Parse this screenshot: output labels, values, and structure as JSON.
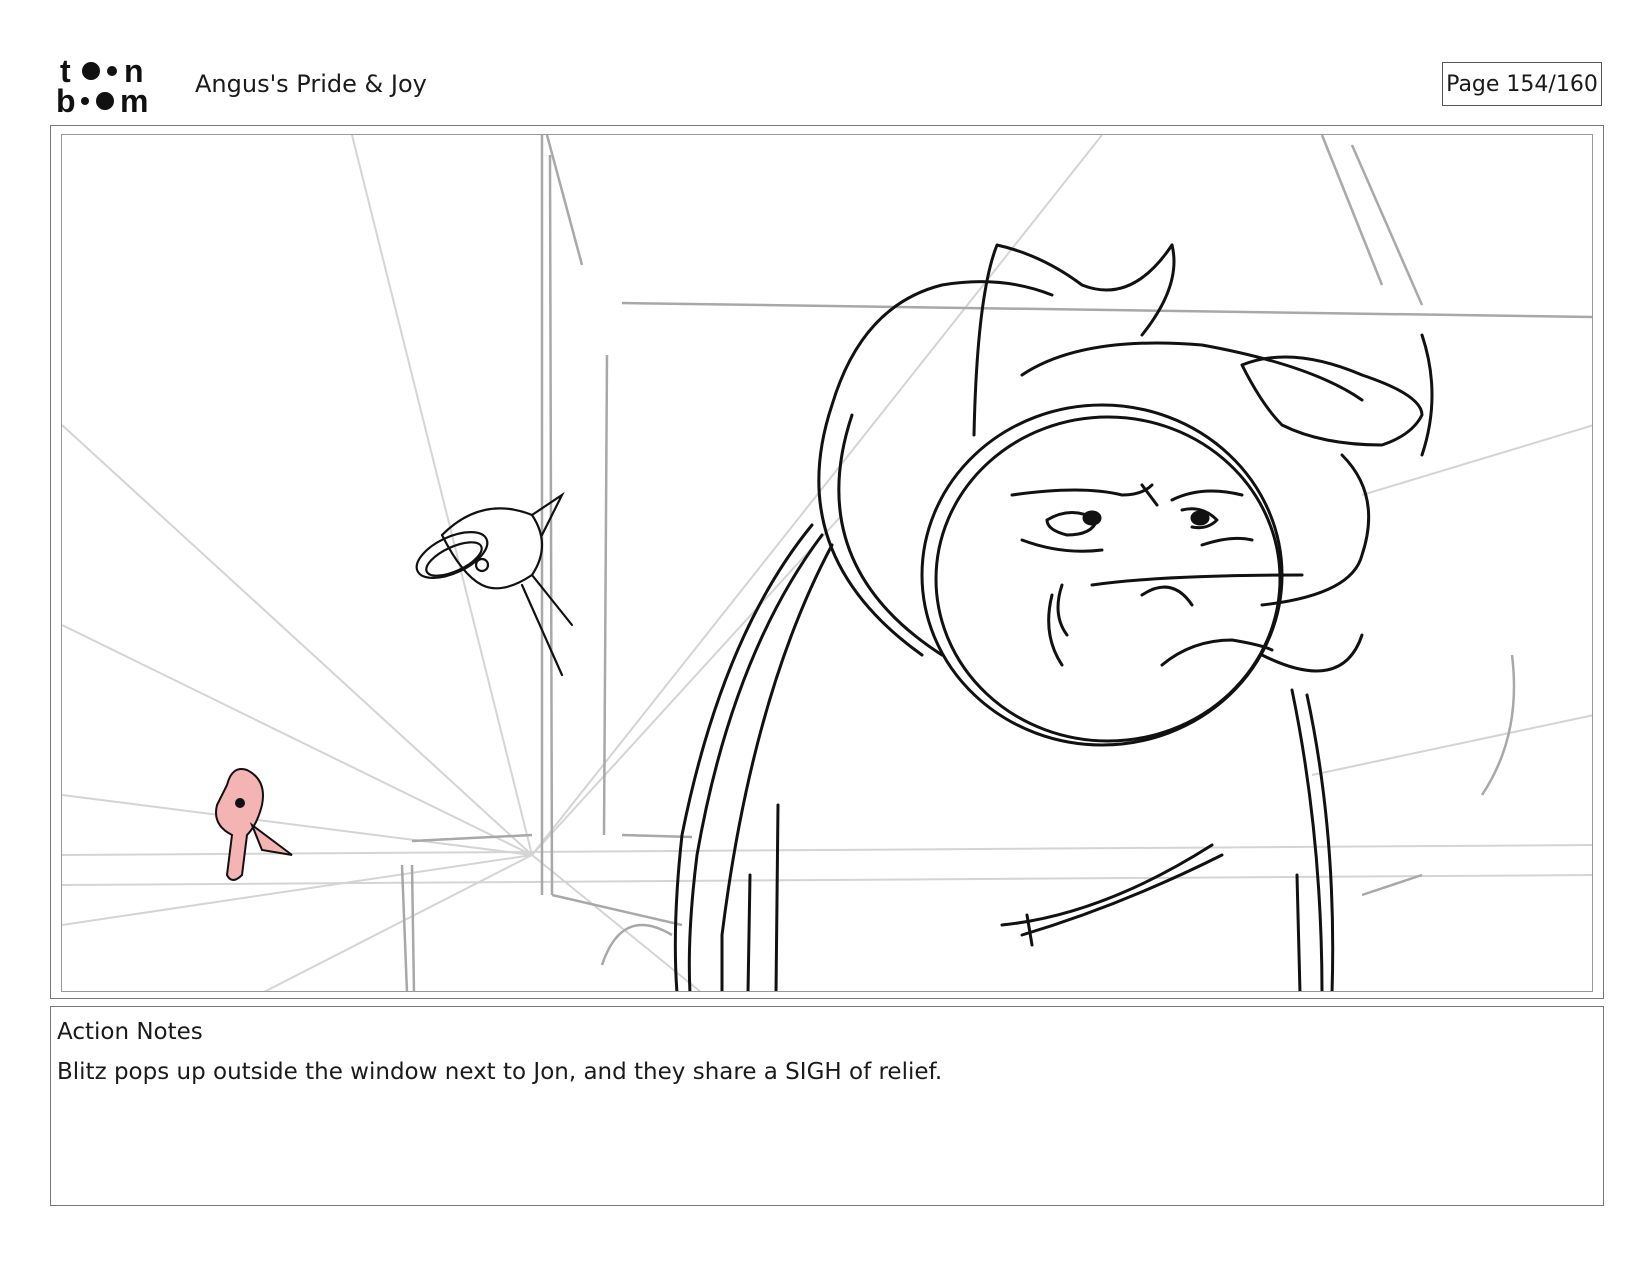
{
  "header": {
    "logo_name": "toon boom",
    "project_title": "Angus's Pride & Joy",
    "page_label": "Page 154/160"
  },
  "notes": {
    "heading": "Action Notes",
    "text": "Blitz pops up outside the window next to Jon, and they share a SIGH of relief."
  },
  "colors": {
    "sketch": "#111111",
    "guide": "#bdbdbd",
    "accent_pink": "#f4b4b4"
  }
}
